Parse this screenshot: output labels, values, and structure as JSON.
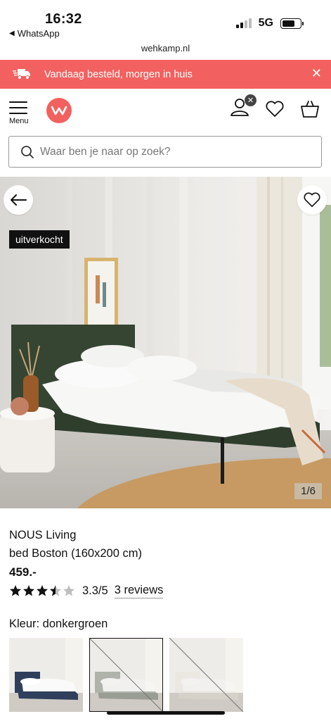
{
  "status_bar": {
    "time": "16:32",
    "back_app": "WhatsApp",
    "network": "5G"
  },
  "browser": {
    "url": "wehkamp.nl"
  },
  "promo": {
    "text": "Vandaag besteld, morgen in huis",
    "icon": "delivery-truck-icon",
    "background": "#f2615f"
  },
  "header": {
    "menu_label": "Menu",
    "logo_color": "#f2615f"
  },
  "search": {
    "placeholder": "Waar ben je naar op zoek?"
  },
  "gallery": {
    "badge": "uitverkocht",
    "counter": "1/6"
  },
  "product": {
    "brand": "NOUS Living",
    "name": "bed Boston (160x200 cm)",
    "price": "459.-",
    "rating_value": 3.3,
    "rating_max": 5,
    "rating_text": "3.3/5",
    "reviews_text": "3 reviews",
    "color_label": "Kleur: donkergroen",
    "variants": [
      {
        "name": "blue",
        "selected": false,
        "available": true,
        "color": "#2f3f5c"
      },
      {
        "name": "donkergroen",
        "selected": true,
        "available": false,
        "color": "#3b4a3a"
      },
      {
        "name": "beige",
        "selected": false,
        "available": false,
        "color": "#e6e0d5"
      }
    ]
  }
}
